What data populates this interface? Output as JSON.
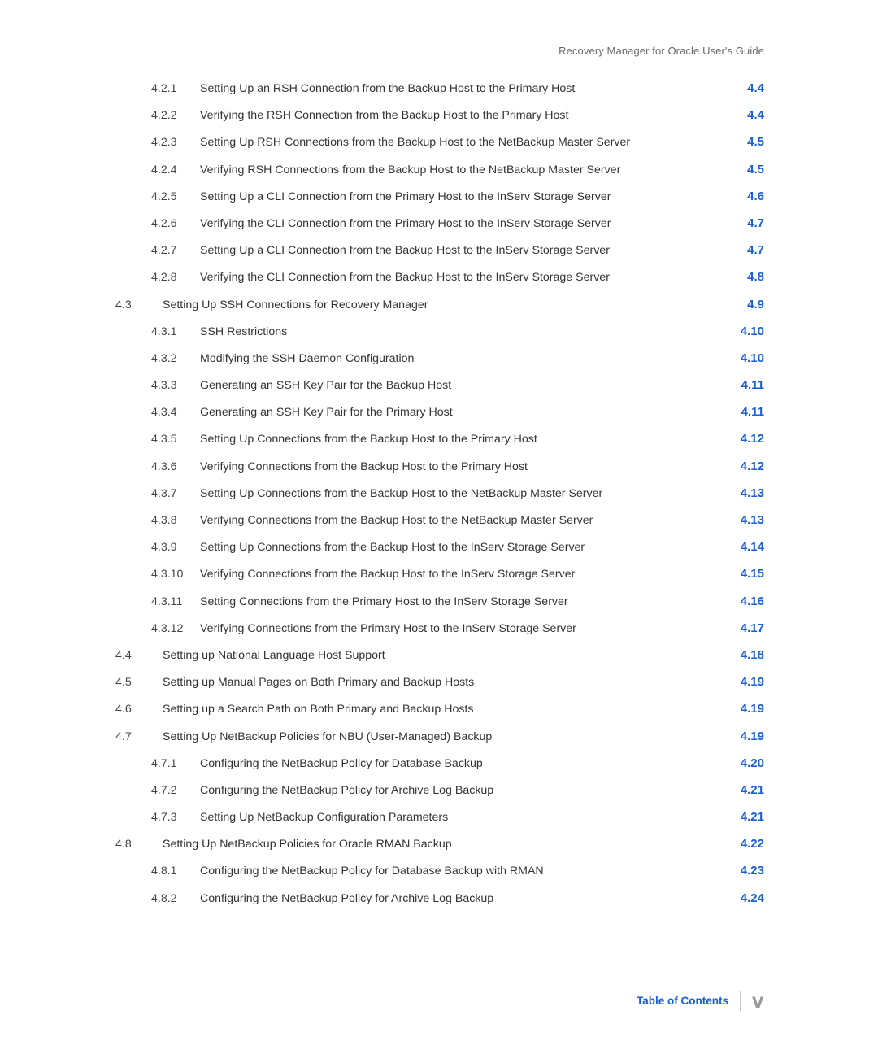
{
  "header": {
    "running": "Recovery Manager for Oracle User's Guide"
  },
  "toc": [
    {
      "level": "sub",
      "num": "4.2.1",
      "title": "Setting Up an RSH Connection from the Backup Host to the Primary Host",
      "page": "4.4"
    },
    {
      "level": "sub",
      "num": "4.2.2",
      "title": "Verifying the RSH Connection from the Backup Host to the Primary Host",
      "page": "4.4"
    },
    {
      "level": "sub",
      "num": "4.2.3",
      "title": "Setting Up RSH Connections from the Backup Host to the NetBackup Master Server",
      "page": "4.5"
    },
    {
      "level": "sub",
      "num": "4.2.4",
      "title": "Verifying RSH Connections from the Backup Host to the NetBackup Master Server",
      "page": "4.5"
    },
    {
      "level": "sub",
      "num": "4.2.5",
      "title": "Setting Up a CLI Connection from the Primary Host to the InServ Storage Server",
      "page": "4.6"
    },
    {
      "level": "sub",
      "num": "4.2.6",
      "title": "Verifying the CLI Connection from the Primary Host to the InServ Storage Server",
      "page": "4.7"
    },
    {
      "level": "sub",
      "num": "4.2.7",
      "title": "Setting Up a CLI Connection from the Backup Host to the InServ Storage Server",
      "page": "4.7"
    },
    {
      "level": "sub",
      "num": "4.2.8",
      "title": "Verifying the CLI Connection from the Backup Host to the InServ Storage Server",
      "page": "4.8"
    },
    {
      "level": "sec",
      "num": "4.3",
      "title": "Setting Up SSH Connections for Recovery Manager",
      "page": "4.9"
    },
    {
      "level": "sub",
      "num": "4.3.1",
      "title": "SSH Restrictions",
      "page": "4.10"
    },
    {
      "level": "sub",
      "num": "4.3.2",
      "title": "Modifying the SSH Daemon Configuration",
      "page": "4.10"
    },
    {
      "level": "sub",
      "num": "4.3.3",
      "title": "Generating an SSH Key Pair for the Backup Host",
      "page": "4.11"
    },
    {
      "level": "sub",
      "num": "4.3.4",
      "title": "Generating an SSH Key Pair for the Primary Host",
      "page": "4.11"
    },
    {
      "level": "sub",
      "num": "4.3.5",
      "title": "Setting Up Connections from the Backup Host to the Primary Host",
      "page": "4.12"
    },
    {
      "level": "sub",
      "num": "4.3.6",
      "title": "Verifying Connections from the Backup Host to the Primary Host",
      "page": "4.12"
    },
    {
      "level": "sub",
      "num": "4.3.7",
      "title": "Setting Up Connections from the Backup Host to the NetBackup Master Server",
      "page": "4.13"
    },
    {
      "level": "sub",
      "num": "4.3.8",
      "title": "Verifying Connections from the Backup Host to the NetBackup Master Server",
      "page": "4.13"
    },
    {
      "level": "sub",
      "num": "4.3.9",
      "title": "Setting Up Connections from the Backup Host to the InServ Storage Server",
      "page": "4.14"
    },
    {
      "level": "sub",
      "num": "4.3.10",
      "title": "Verifying Connections from the Backup Host to the InServ Storage Server",
      "page": "4.15"
    },
    {
      "level": "sub",
      "num": "4.3.11",
      "title": "Setting Connections from the Primary Host to the InServ Storage Server",
      "page": "4.16"
    },
    {
      "level": "sub",
      "num": "4.3.12",
      "title": "Verifying Connections from the Primary Host to the InServ Storage Server",
      "page": "4.17"
    },
    {
      "level": "sec",
      "num": "4.4",
      "title": "Setting up National Language Host Support",
      "page": "4.18"
    },
    {
      "level": "sec",
      "num": "4.5",
      "title": "Setting up Manual Pages on Both Primary and Backup Hosts",
      "page": "4.19"
    },
    {
      "level": "sec",
      "num": "4.6",
      "title": "Setting up a Search Path on Both Primary and Backup Hosts",
      "page": "4.19"
    },
    {
      "level": "sec",
      "num": "4.7",
      "title": "Setting Up NetBackup Policies for NBU (User-Managed) Backup",
      "page": "4.19"
    },
    {
      "level": "sub",
      "num": "4.7.1",
      "title": "Configuring the NetBackup Policy for Database Backup",
      "page": "4.20"
    },
    {
      "level": "sub",
      "num": "4.7.2",
      "title": "Configuring the NetBackup Policy for Archive Log Backup",
      "page": "4.21"
    },
    {
      "level": "sub",
      "num": "4.7.3",
      "title": "Setting Up NetBackup Configuration Parameters",
      "page": "4.21"
    },
    {
      "level": "sec",
      "num": "4.8",
      "title": "Setting Up NetBackup Policies for Oracle RMAN Backup",
      "page": "4.22"
    },
    {
      "level": "sub",
      "num": "4.8.1",
      "title": "Configuring the NetBackup Policy for Database Backup with RMAN",
      "page": "4.23"
    },
    {
      "level": "sub",
      "num": "4.8.2",
      "title": "Configuring the NetBackup Policy for Archive Log Backup",
      "page": "4.24"
    }
  ],
  "footer": {
    "label": "Table of Contents",
    "pagenum": "v"
  }
}
